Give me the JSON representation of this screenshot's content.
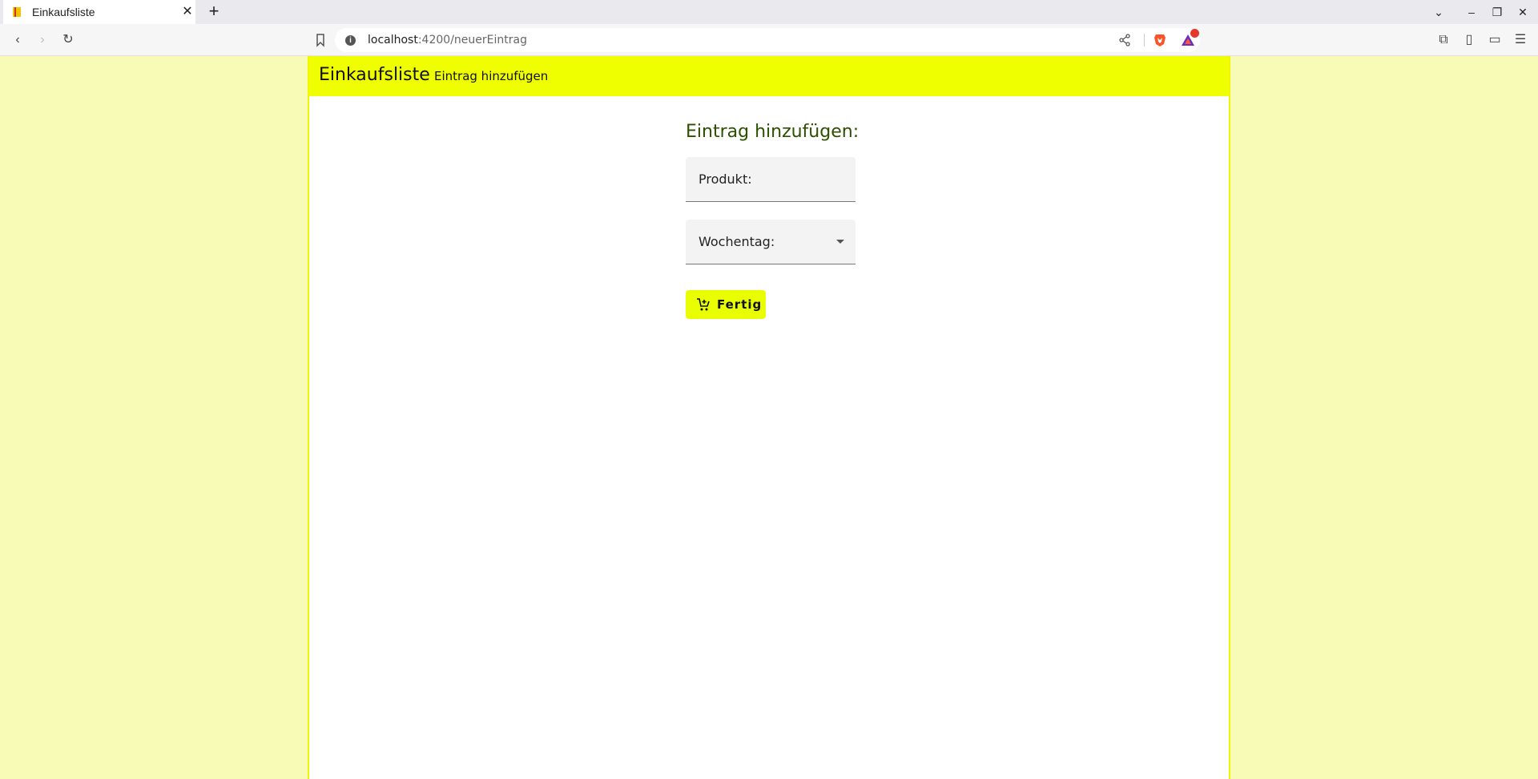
{
  "browser": {
    "tab_title": "Einkaufsliste",
    "url_host": "localhost",
    "url_rest": ":4200/neuerEintrag"
  },
  "app": {
    "title": "Einkaufsliste",
    "nav_link": "Eintrag hinzufügen"
  },
  "form": {
    "heading": "Eintrag hinzufügen:",
    "product_label": "Produkt:",
    "product_value": "",
    "weekday_label": "Wochentag:",
    "submit_label": "Fertig"
  },
  "colors": {
    "page_background": "#f8fbb6",
    "appbar": "#f0ff00",
    "button": "#e9ff00",
    "heading": "#2c5000"
  }
}
